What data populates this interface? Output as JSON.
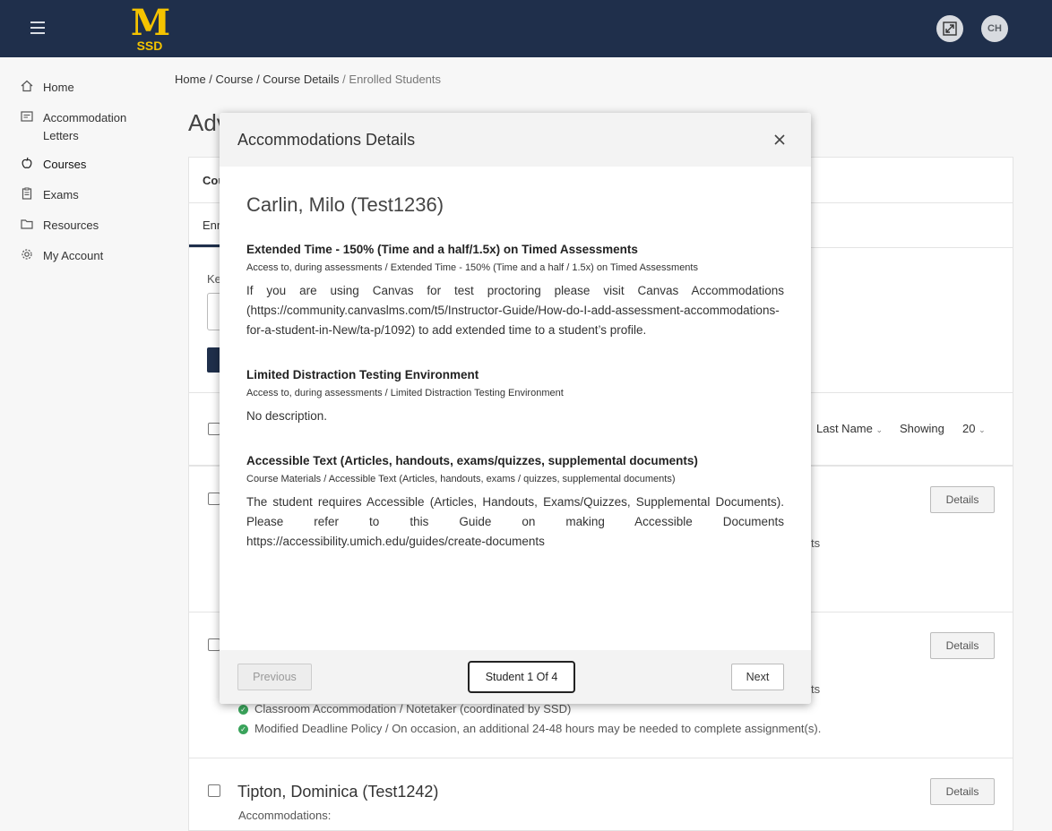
{
  "header": {
    "logo_text": "M",
    "logo_subtext": "SSD",
    "avatar_initials": "CH",
    "brand_color": "#1f2f4b",
    "logo_color": "#f4c300"
  },
  "sidebar": {
    "items": [
      {
        "label": "Home",
        "icon": "home-icon"
      },
      {
        "label": "Accommodation Letters",
        "icon": "letter-icon"
      },
      {
        "label": "Courses",
        "icon": "apple-icon"
      },
      {
        "label": "Exams",
        "icon": "clipboard-icon"
      },
      {
        "label": "Resources",
        "icon": "folder-icon"
      },
      {
        "label": "My Account",
        "icon": "gear-icon"
      }
    ]
  },
  "breadcrumb": {
    "items": [
      "Home",
      "Course",
      "Course Details"
    ],
    "separator": " / ",
    "current": "Enrolled Students"
  },
  "background": {
    "title_partial": "Adv",
    "tab_partial_1": "Cou",
    "tab_partial_2": "Enr",
    "keyword_partial": "Ke",
    "sort_label": "Last Name",
    "showing_label": "Showing",
    "showing_value": "20",
    "details_label": "Details",
    "row_partial_text_1": "ts",
    "row_partial_text_2": "ts",
    "row2_items": [
      "Classroom Accommodation / Notetaker (coordinated by SSD)",
      "Modified Deadline Policy / On occasion, an additional 24-48 hours may be needed to complete assignment(s)."
    ],
    "row3_name": "Tipton, Dominica (Test1242)",
    "row3_partial": "Accommodations:"
  },
  "modal": {
    "title": "Accommodations Details",
    "student_name": "Carlin, Milo (Test1236)",
    "accommodations": [
      {
        "title": "Extended Time - 150% (Time and a half/1.5x) on Timed Assessments",
        "path": "Access to, during assessments / Extended Time - 150% (Time and a half / 1.5x) on Timed Assessments",
        "description": "If you are using Canvas for test proctoring please visit Canvas Accommodations (https://community.canvaslms.com/t5/Instructor-Guide/How-do-I-add-assessment-accommodations-for-a-student-in-New/ta-p/1092) to add extended time to a student’s profile."
      },
      {
        "title": "Limited Distraction Testing Environment",
        "path": "Access to, during assessments / Limited Distraction Testing Environment",
        "description": "No description."
      },
      {
        "title": "Accessible Text (Articles, handouts, exams/quizzes, supplemental documents)",
        "path": "Course Materials / Accessible Text (Articles, handouts, exams / quizzes, supplemental documents)",
        "description": "The student requires Accessible (Articles, Handouts, Exams/Quizzes, Supplemental Documents). Please refer to this Guide on making Accessible Documents https://accessibility.umich.edu/guides/create-documents"
      }
    ],
    "footer": {
      "previous_label": "Previous",
      "counter_label": "Student 1 Of 4",
      "next_label": "Next"
    }
  }
}
